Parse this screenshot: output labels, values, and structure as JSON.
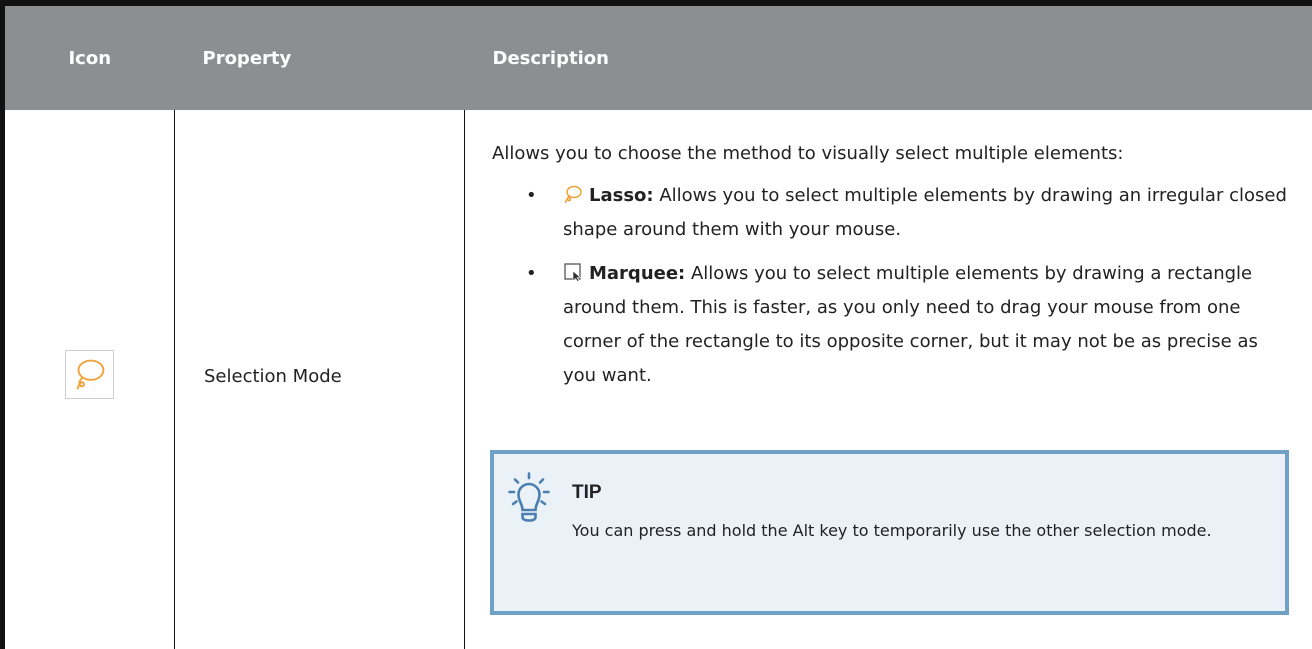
{
  "table": {
    "headers": {
      "icon": "Icon",
      "property": "Property",
      "description": "Description"
    },
    "row": {
      "icon_name": "lasso-icon",
      "property": "Selection Mode",
      "intro": "Allows you to choose the method to visually select multiple elements:",
      "options": [
        {
          "icon": "lasso-icon",
          "name": "Lasso:",
          "text": "Allows you to select multiple elements by drawing an irregular closed shape around them with your mouse."
        },
        {
          "icon": "marquee-icon",
          "name": "Marquee:",
          "text": "Allows you to select multiple elements by drawing a rectangle around them. This is faster, as you only need to drag your mouse from one corner of the rectangle to its opposite corner, but it may not be as precise as you want."
        }
      ],
      "tip": {
        "icon": "lightbulb-icon",
        "title": "TIP",
        "text": "You can press and hold the Alt key to temporarily use the other selection mode."
      }
    }
  },
  "colors": {
    "header_bg": "#8d8e90",
    "border": "#111111",
    "lasso_orange": "#f0a23c",
    "tip_bg": "#eaf1f7",
    "tip_border": "#6fa1c6",
    "tip_icon": "#4a7fb0"
  }
}
